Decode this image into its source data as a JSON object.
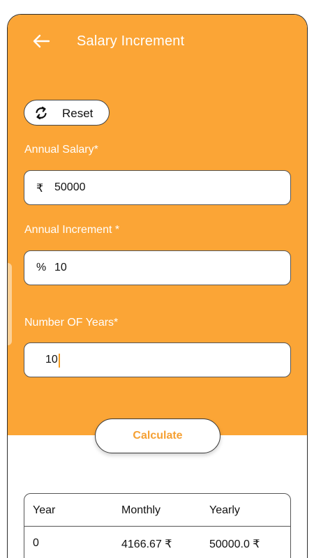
{
  "app_bar": {
    "title": "Salary Increment",
    "back_icon": "arrow-left-icon"
  },
  "reset": {
    "label": "Reset",
    "icon": "refresh-icon"
  },
  "fields": {
    "annual_salary": {
      "label": "Annual Salary*",
      "prefix": "₹",
      "value": "50000"
    },
    "annual_increment": {
      "label": "Annual Increment *",
      "prefix": "%",
      "value": "10"
    },
    "number_of_years": {
      "label": "Number OF Years*",
      "value": "10"
    }
  },
  "calculate": {
    "label": "Calculate"
  },
  "results": {
    "columns": [
      "Year",
      "Monthly",
      "Yearly"
    ],
    "rows": [
      [
        "0",
        "4166.67 ₹",
        "50000.0 ₹"
      ]
    ]
  },
  "colors": {
    "accent": "#fba536",
    "button_text": "#f5a033",
    "caret": "#f29a1f"
  }
}
